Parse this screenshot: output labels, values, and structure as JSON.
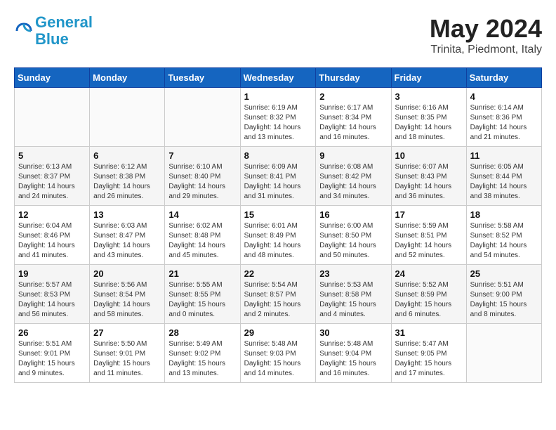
{
  "header": {
    "logo_line1": "General",
    "logo_line2": "Blue",
    "title": "May 2024",
    "subtitle": "Trinita, Piedmont, Italy"
  },
  "weekdays": [
    "Sunday",
    "Monday",
    "Tuesday",
    "Wednesday",
    "Thursday",
    "Friday",
    "Saturday"
  ],
  "weeks": [
    [
      {
        "day": "",
        "sunrise": "",
        "sunset": "",
        "daylight": ""
      },
      {
        "day": "",
        "sunrise": "",
        "sunset": "",
        "daylight": ""
      },
      {
        "day": "",
        "sunrise": "",
        "sunset": "",
        "daylight": ""
      },
      {
        "day": "1",
        "sunrise": "Sunrise: 6:19 AM",
        "sunset": "Sunset: 8:32 PM",
        "daylight": "Daylight: 14 hours and 13 minutes."
      },
      {
        "day": "2",
        "sunrise": "Sunrise: 6:17 AM",
        "sunset": "Sunset: 8:34 PM",
        "daylight": "Daylight: 14 hours and 16 minutes."
      },
      {
        "day": "3",
        "sunrise": "Sunrise: 6:16 AM",
        "sunset": "Sunset: 8:35 PM",
        "daylight": "Daylight: 14 hours and 18 minutes."
      },
      {
        "day": "4",
        "sunrise": "Sunrise: 6:14 AM",
        "sunset": "Sunset: 8:36 PM",
        "daylight": "Daylight: 14 hours and 21 minutes."
      }
    ],
    [
      {
        "day": "5",
        "sunrise": "Sunrise: 6:13 AM",
        "sunset": "Sunset: 8:37 PM",
        "daylight": "Daylight: 14 hours and 24 minutes."
      },
      {
        "day": "6",
        "sunrise": "Sunrise: 6:12 AM",
        "sunset": "Sunset: 8:38 PM",
        "daylight": "Daylight: 14 hours and 26 minutes."
      },
      {
        "day": "7",
        "sunrise": "Sunrise: 6:10 AM",
        "sunset": "Sunset: 8:40 PM",
        "daylight": "Daylight: 14 hours and 29 minutes."
      },
      {
        "day": "8",
        "sunrise": "Sunrise: 6:09 AM",
        "sunset": "Sunset: 8:41 PM",
        "daylight": "Daylight: 14 hours and 31 minutes."
      },
      {
        "day": "9",
        "sunrise": "Sunrise: 6:08 AM",
        "sunset": "Sunset: 8:42 PM",
        "daylight": "Daylight: 14 hours and 34 minutes."
      },
      {
        "day": "10",
        "sunrise": "Sunrise: 6:07 AM",
        "sunset": "Sunset: 8:43 PM",
        "daylight": "Daylight: 14 hours and 36 minutes."
      },
      {
        "day": "11",
        "sunrise": "Sunrise: 6:05 AM",
        "sunset": "Sunset: 8:44 PM",
        "daylight": "Daylight: 14 hours and 38 minutes."
      }
    ],
    [
      {
        "day": "12",
        "sunrise": "Sunrise: 6:04 AM",
        "sunset": "Sunset: 8:46 PM",
        "daylight": "Daylight: 14 hours and 41 minutes."
      },
      {
        "day": "13",
        "sunrise": "Sunrise: 6:03 AM",
        "sunset": "Sunset: 8:47 PM",
        "daylight": "Daylight: 14 hours and 43 minutes."
      },
      {
        "day": "14",
        "sunrise": "Sunrise: 6:02 AM",
        "sunset": "Sunset: 8:48 PM",
        "daylight": "Daylight: 14 hours and 45 minutes."
      },
      {
        "day": "15",
        "sunrise": "Sunrise: 6:01 AM",
        "sunset": "Sunset: 8:49 PM",
        "daylight": "Daylight: 14 hours and 48 minutes."
      },
      {
        "day": "16",
        "sunrise": "Sunrise: 6:00 AM",
        "sunset": "Sunset: 8:50 PM",
        "daylight": "Daylight: 14 hours and 50 minutes."
      },
      {
        "day": "17",
        "sunrise": "Sunrise: 5:59 AM",
        "sunset": "Sunset: 8:51 PM",
        "daylight": "Daylight: 14 hours and 52 minutes."
      },
      {
        "day": "18",
        "sunrise": "Sunrise: 5:58 AM",
        "sunset": "Sunset: 8:52 PM",
        "daylight": "Daylight: 14 hours and 54 minutes."
      }
    ],
    [
      {
        "day": "19",
        "sunrise": "Sunrise: 5:57 AM",
        "sunset": "Sunset: 8:53 PM",
        "daylight": "Daylight: 14 hours and 56 minutes."
      },
      {
        "day": "20",
        "sunrise": "Sunrise: 5:56 AM",
        "sunset": "Sunset: 8:54 PM",
        "daylight": "Daylight: 14 hours and 58 minutes."
      },
      {
        "day": "21",
        "sunrise": "Sunrise: 5:55 AM",
        "sunset": "Sunset: 8:55 PM",
        "daylight": "Daylight: 15 hours and 0 minutes."
      },
      {
        "day": "22",
        "sunrise": "Sunrise: 5:54 AM",
        "sunset": "Sunset: 8:57 PM",
        "daylight": "Daylight: 15 hours and 2 minutes."
      },
      {
        "day": "23",
        "sunrise": "Sunrise: 5:53 AM",
        "sunset": "Sunset: 8:58 PM",
        "daylight": "Daylight: 15 hours and 4 minutes."
      },
      {
        "day": "24",
        "sunrise": "Sunrise: 5:52 AM",
        "sunset": "Sunset: 8:59 PM",
        "daylight": "Daylight: 15 hours and 6 minutes."
      },
      {
        "day": "25",
        "sunrise": "Sunrise: 5:51 AM",
        "sunset": "Sunset: 9:00 PM",
        "daylight": "Daylight: 15 hours and 8 minutes."
      }
    ],
    [
      {
        "day": "26",
        "sunrise": "Sunrise: 5:51 AM",
        "sunset": "Sunset: 9:01 PM",
        "daylight": "Daylight: 15 hours and 9 minutes."
      },
      {
        "day": "27",
        "sunrise": "Sunrise: 5:50 AM",
        "sunset": "Sunset: 9:01 PM",
        "daylight": "Daylight: 15 hours and 11 minutes."
      },
      {
        "day": "28",
        "sunrise": "Sunrise: 5:49 AM",
        "sunset": "Sunset: 9:02 PM",
        "daylight": "Daylight: 15 hours and 13 minutes."
      },
      {
        "day": "29",
        "sunrise": "Sunrise: 5:48 AM",
        "sunset": "Sunset: 9:03 PM",
        "daylight": "Daylight: 15 hours and 14 minutes."
      },
      {
        "day": "30",
        "sunrise": "Sunrise: 5:48 AM",
        "sunset": "Sunset: 9:04 PM",
        "daylight": "Daylight: 15 hours and 16 minutes."
      },
      {
        "day": "31",
        "sunrise": "Sunrise: 5:47 AM",
        "sunset": "Sunset: 9:05 PM",
        "daylight": "Daylight: 15 hours and 17 minutes."
      },
      {
        "day": "",
        "sunrise": "",
        "sunset": "",
        "daylight": ""
      }
    ]
  ]
}
